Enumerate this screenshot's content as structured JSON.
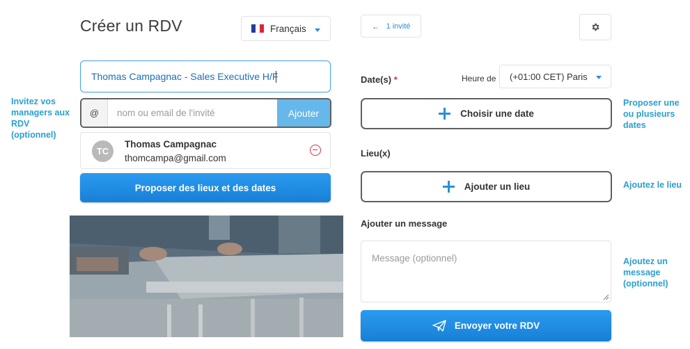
{
  "notes": {
    "invite": "Invitez vos\nmanagers aux\nRDV\n(optionnel)",
    "dates": "Proposer une\nou plusieurs\ndates",
    "place": "Ajoutez le lieu",
    "message": "Ajoutez un\nmessage\n(optionnel)"
  },
  "header": {
    "title": "Créer un RDV",
    "language": "Français"
  },
  "form": {
    "title_value": "Thomas Campagnac - Sales Executive H/F",
    "invite_prefix": "@",
    "invite_placeholder": "nom ou email de l'invité",
    "invite_button": "Ajouter",
    "guest": {
      "initials": "TC",
      "name": "Thomas Campagnac",
      "email": "thomcampa@gmail.com"
    },
    "propose_button": "Proposer des lieux et des dates"
  },
  "right": {
    "guest_count": "1 invité",
    "dates_label": "Date(s)",
    "required_mark": "*",
    "timezone_label": "Heure de",
    "timezone_value": "(+01:00 CET) Paris",
    "choose_date": "Choisir une date",
    "places_label": "Lieu(x)",
    "add_place": "Ajouter un lieu",
    "message_label": "Ajouter un message",
    "message_placeholder": "Message (optionnel)",
    "send_button": "Envoyer votre RDV"
  },
  "colors": {
    "accent": "#2a8ed8",
    "note_text": "#2a9fd0",
    "danger": "#d9303e"
  }
}
